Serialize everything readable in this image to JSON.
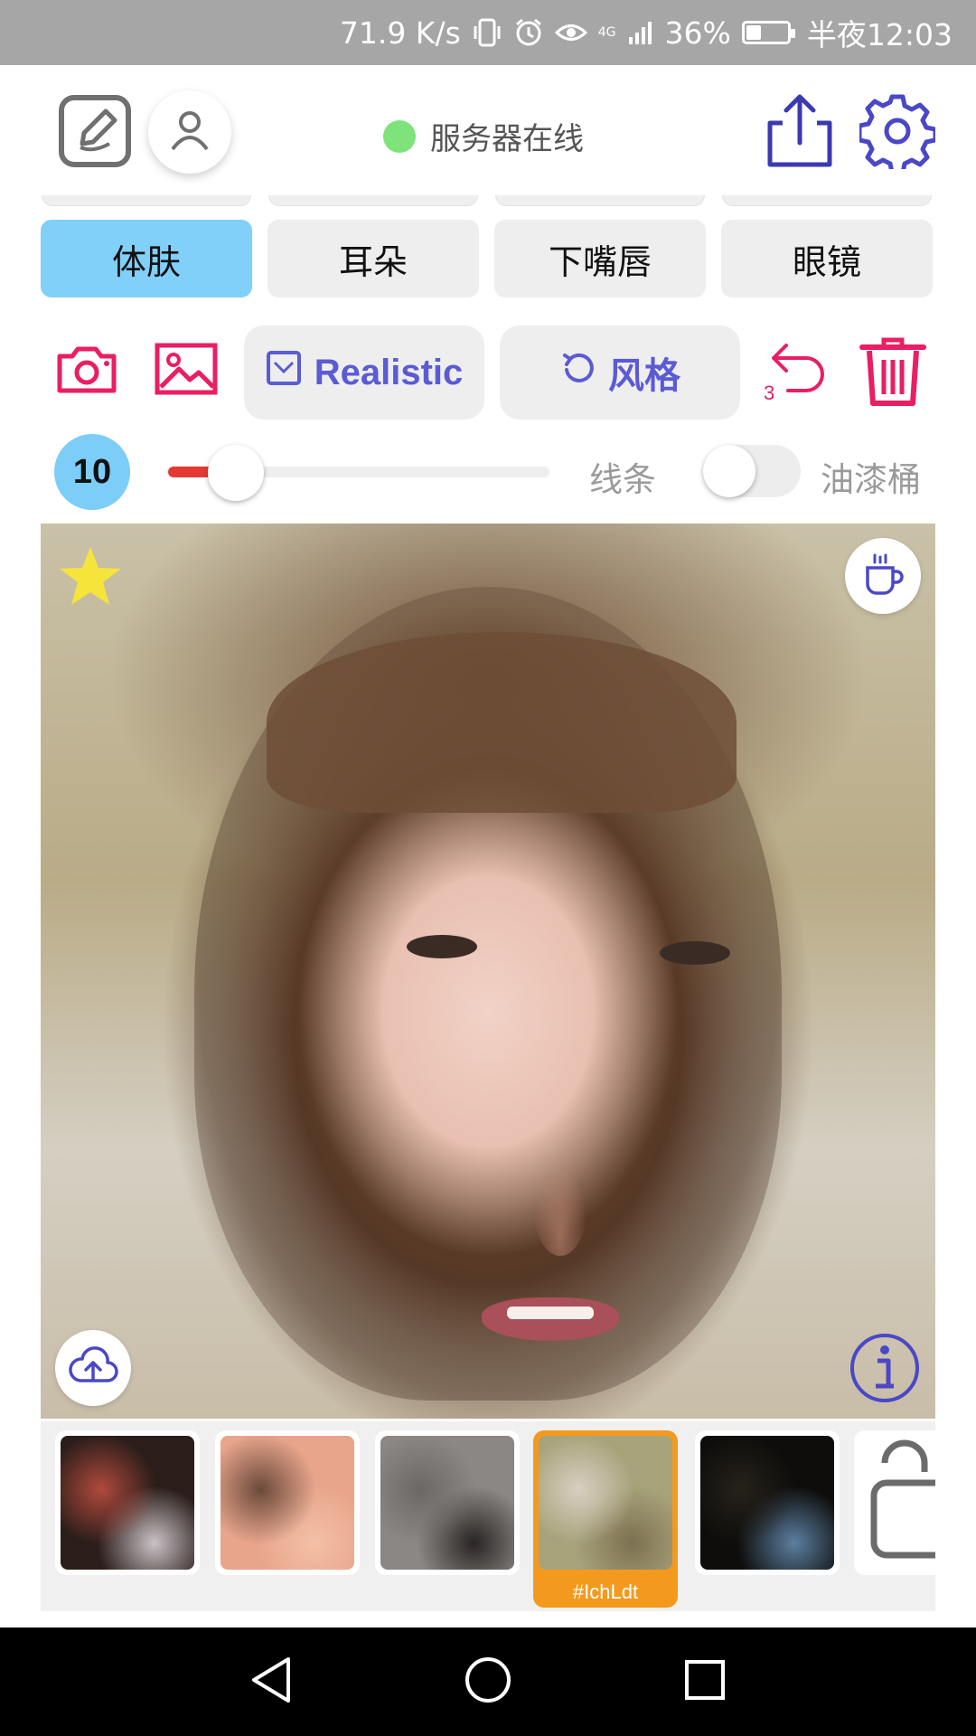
{
  "status_bar": {
    "net_speed": "71.9 K/s",
    "network_badge": "4G",
    "battery_pct": "36%",
    "battery_level": 0.36,
    "time": "半夜12:03",
    "icons": [
      "vibrate-icon",
      "alarm-icon",
      "eye-icon",
      "signal-icon",
      "battery-icon"
    ]
  },
  "header": {
    "server_status": "服务器在线",
    "server_status_color": "#7ee37a",
    "icons": [
      "edit-icon",
      "profile-icon",
      "share-icon",
      "gear-icon"
    ]
  },
  "categories": [
    {
      "label": "体肤",
      "active": true
    },
    {
      "label": "耳朵",
      "active": false
    },
    {
      "label": "下嘴唇",
      "active": false
    },
    {
      "label": "眼镜",
      "active": false
    }
  ],
  "toolbar": {
    "realistic_label": "Realistic",
    "style_label": "风格",
    "undo_count": "3",
    "accent_color": "#e91e63",
    "pill_color": "#5b5bd4"
  },
  "brush": {
    "size": "10",
    "slider_value": 0.08,
    "line_label": "线条",
    "bucket_label": "油漆桶",
    "bucket_enabled": false
  },
  "canvas": {
    "favorite": true,
    "icons": [
      "star-icon",
      "coffee-icon",
      "cloud-upload-icon",
      "info-icon"
    ]
  },
  "thumbnails": [
    {
      "colors": [
        "#2a1d1a",
        "#b04a3c",
        "#c9c2c6"
      ],
      "selected": false
    },
    {
      "colors": [
        "#e8a58c",
        "#6b4a3a",
        "#f3c0a6"
      ],
      "selected": false
    },
    {
      "colors": [
        "#8b8784",
        "#6c6866",
        "#2a2524"
      ],
      "selected": false
    },
    {
      "colors": [
        "#a7a27a",
        "#d8cfc2",
        "#7c7050"
      ],
      "selected": true,
      "caption": "#IchLdt"
    },
    {
      "colors": [
        "#0e0d0b",
        "#26221b",
        "#5b7fa0"
      ],
      "selected": false
    }
  ],
  "nav": {
    "icons": [
      "back-icon",
      "home-icon",
      "recents-icon"
    ]
  }
}
